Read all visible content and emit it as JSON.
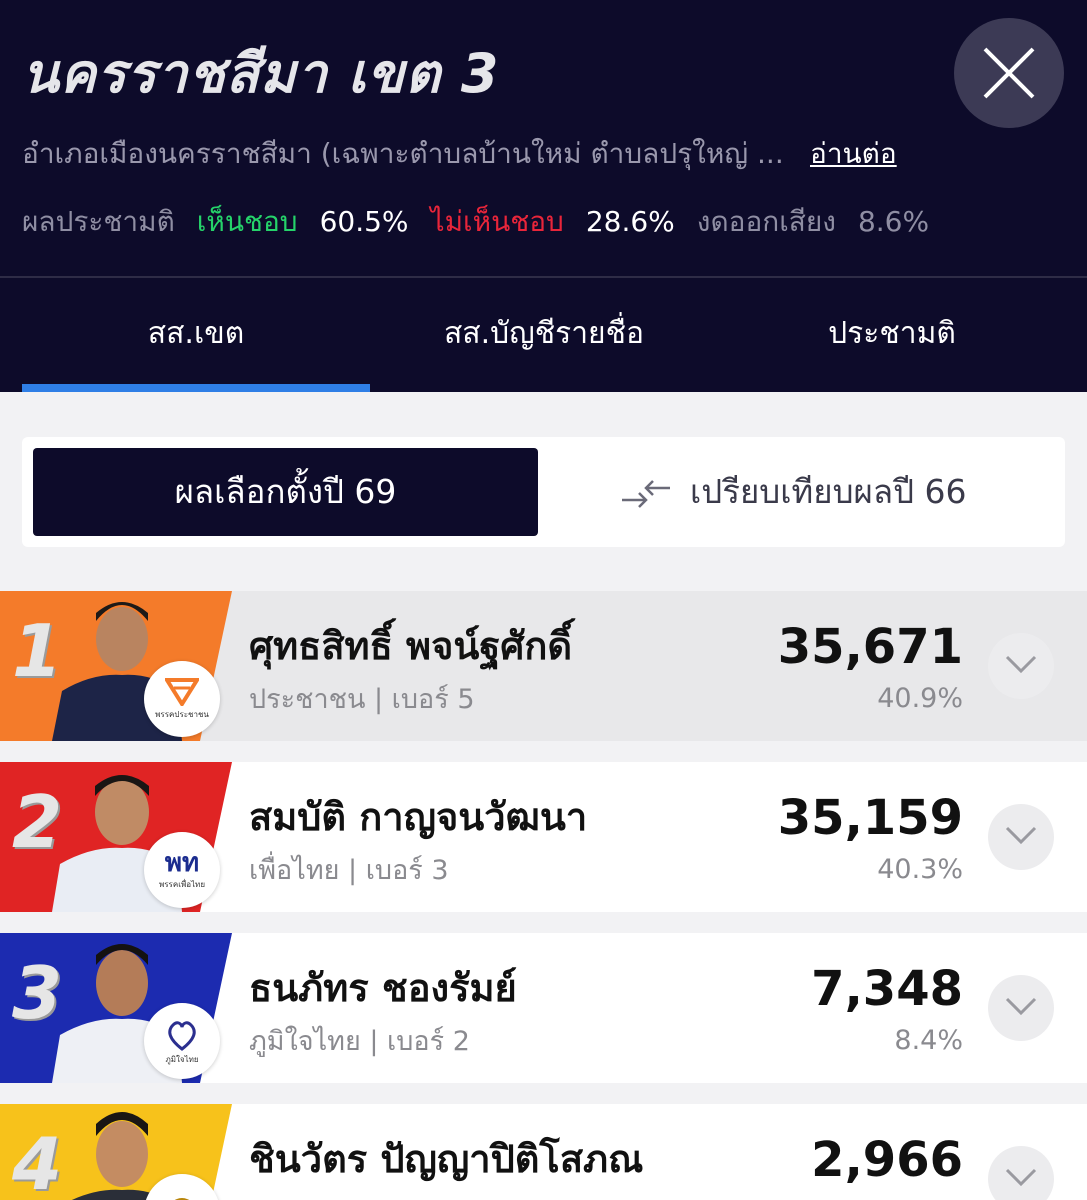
{
  "header": {
    "title": "นครราชสีมา เขต 3",
    "subtitle": "อำเภอเมืองนครราชสีมา (เฉพาะตำบลบ้านใหม่ ตำบลปรุใหญ่ ...",
    "read_more": "อ่านต่อ",
    "referendum": {
      "label": "ผลประชามติ",
      "yes_label": "เห็นชอบ",
      "yes_value": "60.5%",
      "no_label": "ไม่เห็นชอบ",
      "no_value": "28.6%",
      "abstain_label": "งดออกเสียง",
      "abstain_value": "8.6%"
    }
  },
  "tabs": [
    {
      "label": "สส.เขต",
      "active": true
    },
    {
      "label": "สส.บัญชีรายชื่อ",
      "active": false
    },
    {
      "label": "ประชามติ",
      "active": false
    }
  ],
  "toggle": {
    "active_label": "ผลเลือกตั้งปี 69",
    "compare_label": "เปรียบเทียบผลปี 66"
  },
  "candidates": [
    {
      "rank": "1",
      "name": "ศุทธสิทธิ์ พจน์ฐศักดิ์",
      "party_line": "ประชาชน | เบอร์ 5",
      "votes": "35,671",
      "pct": "40.9%",
      "rank_color": "#f47b2a",
      "party_logo": "พรรคประชาชน"
    },
    {
      "rank": "2",
      "name": "สมบัติ กาญจนวัฒนา",
      "party_line": "เพื่อไทย | เบอร์ 3",
      "votes": "35,159",
      "pct": "40.3%",
      "rank_color": "#e02424",
      "party_logo": "พรรคเพื่อไทย"
    },
    {
      "rank": "3",
      "name": "ธนภัทร ชองรัมย์",
      "party_line": "ภูมิใจไทย | เบอร์ 2",
      "votes": "7,348",
      "pct": "8.4%",
      "rank_color": "#1c2bb0",
      "party_logo": "ภูมิใจไทย"
    },
    {
      "rank": "4",
      "name": "ชินวัตร ปัญญาปิติโสภณ",
      "party_line": "",
      "votes": "2,966",
      "pct": "",
      "rank_color": "#f7c21b",
      "party_logo": ""
    }
  ]
}
